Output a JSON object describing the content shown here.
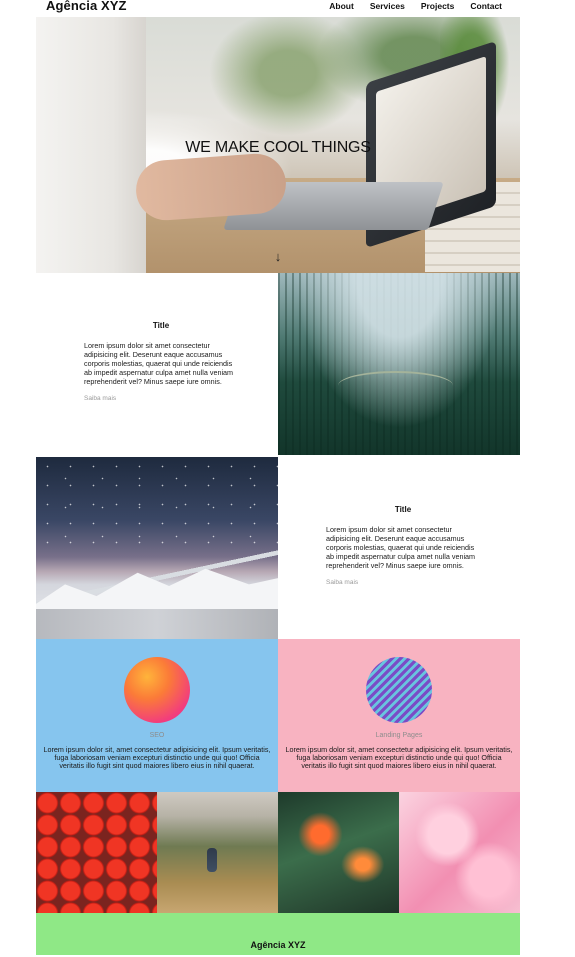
{
  "header": {
    "brand": "Agência XYZ",
    "nav": [
      "About",
      "Services",
      "Projects",
      "Contact"
    ]
  },
  "hero": {
    "title": "WE MAKE COOL THINGS",
    "arrow": "↓"
  },
  "sections": [
    {
      "title": "Title",
      "body": "Lorem ipsum dolor sit amet consectetur adipisicing elit. Deserunt eaque accusamus corporis molestias, quaerat qui unde reiciendis ab impedit aspernatur culpa amet nulla veniam reprehenderit vel? Minus saepe iure omnis.",
      "more": "Saiba mais"
    },
    {
      "title": "Title",
      "body": "Lorem ipsum dolor sit amet consectetur adipisicing elit. Deserunt eaque accusamus corporis molestias, quaerat qui unde reiciendis ab impedit aspernatur culpa amet nulla veniam reprehenderit vel? Minus saepe iure omnis.",
      "more": "Saiba mais"
    }
  ],
  "features": [
    {
      "label": "SEO",
      "desc": "Lorem ipsum dolor sit, amet consectetur adipisicing elit. Ipsum veritatis, fuga laboriosam veniam excepturi distinctio unde qui quo! Officia veritatis illo fugit sint quod maiores libero eius in nihil quaerat."
    },
    {
      "label": "Landing Pages",
      "desc": "Lorem ipsum dolor sit, amet consectetur adipisicing elit. Ipsum veritatis, fuga laboriosam veniam excepturi distinctio unde qui quo! Officia veritatis illo fugit sint quod maiores libero eius in nihil quaerat."
    }
  ],
  "footer": {
    "brand": "Agência XYZ"
  },
  "colors": {
    "seo_bg": "#86c5ee",
    "landing_bg": "#f8b3c1",
    "footer_bg": "#8fe886"
  }
}
